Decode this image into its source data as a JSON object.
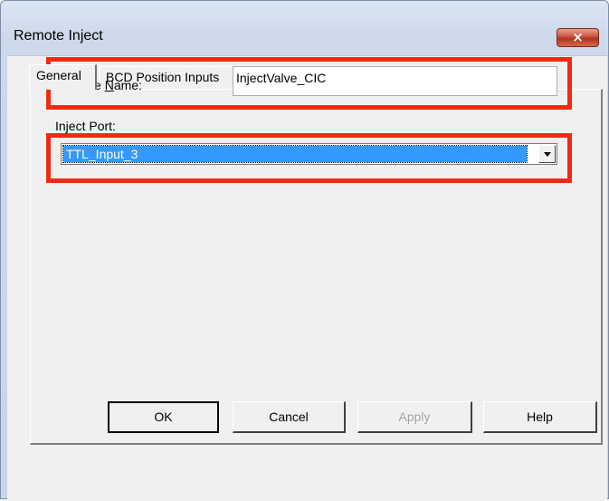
{
  "window": {
    "title": "Remote Inject",
    "close_glyph": "×"
  },
  "tabs": [
    {
      "label": "General",
      "selected": true
    },
    {
      "label": "BCD Position Inputs",
      "selected": false
    }
  ],
  "general": {
    "device_name_label_pre": "Device ",
    "device_name_label_accel": "N",
    "device_name_label_post": "ame:",
    "device_name_value": "InjectValve_CIC",
    "inject_port_label": "Inject Port:",
    "inject_port_value": "TTL_Input_3"
  },
  "buttons": {
    "ok": "OK",
    "cancel": "Cancel",
    "apply": "Apply",
    "help": "Help"
  },
  "colors": {
    "highlight_box": "#f02b14",
    "selection": "#3399ff"
  }
}
